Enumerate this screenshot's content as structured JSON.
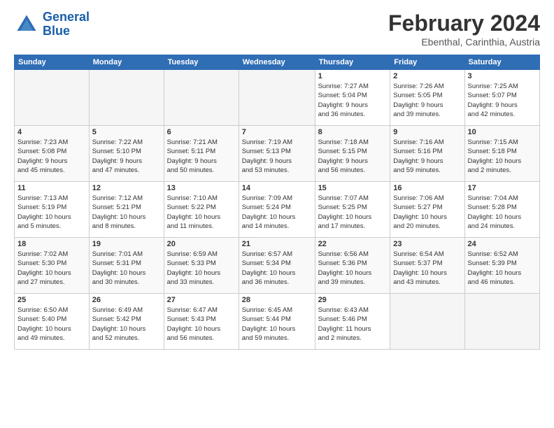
{
  "header": {
    "logo_line1": "General",
    "logo_line2": "Blue",
    "title": "February 2024",
    "subtitle": "Ebenthal, Carinthia, Austria"
  },
  "calendar": {
    "days_of_week": [
      "Sunday",
      "Monday",
      "Tuesday",
      "Wednesday",
      "Thursday",
      "Friday",
      "Saturday"
    ],
    "weeks": [
      [
        {
          "day": "",
          "info": ""
        },
        {
          "day": "",
          "info": ""
        },
        {
          "day": "",
          "info": ""
        },
        {
          "day": "",
          "info": ""
        },
        {
          "day": "1",
          "info": "Sunrise: 7:27 AM\nSunset: 5:04 PM\nDaylight: 9 hours\nand 36 minutes."
        },
        {
          "day": "2",
          "info": "Sunrise: 7:26 AM\nSunset: 5:05 PM\nDaylight: 9 hours\nand 39 minutes."
        },
        {
          "day": "3",
          "info": "Sunrise: 7:25 AM\nSunset: 5:07 PM\nDaylight: 9 hours\nand 42 minutes."
        }
      ],
      [
        {
          "day": "4",
          "info": "Sunrise: 7:23 AM\nSunset: 5:08 PM\nDaylight: 9 hours\nand 45 minutes."
        },
        {
          "day": "5",
          "info": "Sunrise: 7:22 AM\nSunset: 5:10 PM\nDaylight: 9 hours\nand 47 minutes."
        },
        {
          "day": "6",
          "info": "Sunrise: 7:21 AM\nSunset: 5:11 PM\nDaylight: 9 hours\nand 50 minutes."
        },
        {
          "day": "7",
          "info": "Sunrise: 7:19 AM\nSunset: 5:13 PM\nDaylight: 9 hours\nand 53 minutes."
        },
        {
          "day": "8",
          "info": "Sunrise: 7:18 AM\nSunset: 5:15 PM\nDaylight: 9 hours\nand 56 minutes."
        },
        {
          "day": "9",
          "info": "Sunrise: 7:16 AM\nSunset: 5:16 PM\nDaylight: 9 hours\nand 59 minutes."
        },
        {
          "day": "10",
          "info": "Sunrise: 7:15 AM\nSunset: 5:18 PM\nDaylight: 10 hours\nand 2 minutes."
        }
      ],
      [
        {
          "day": "11",
          "info": "Sunrise: 7:13 AM\nSunset: 5:19 PM\nDaylight: 10 hours\nand 5 minutes."
        },
        {
          "day": "12",
          "info": "Sunrise: 7:12 AM\nSunset: 5:21 PM\nDaylight: 10 hours\nand 8 minutes."
        },
        {
          "day": "13",
          "info": "Sunrise: 7:10 AM\nSunset: 5:22 PM\nDaylight: 10 hours\nand 11 minutes."
        },
        {
          "day": "14",
          "info": "Sunrise: 7:09 AM\nSunset: 5:24 PM\nDaylight: 10 hours\nand 14 minutes."
        },
        {
          "day": "15",
          "info": "Sunrise: 7:07 AM\nSunset: 5:25 PM\nDaylight: 10 hours\nand 17 minutes."
        },
        {
          "day": "16",
          "info": "Sunrise: 7:06 AM\nSunset: 5:27 PM\nDaylight: 10 hours\nand 20 minutes."
        },
        {
          "day": "17",
          "info": "Sunrise: 7:04 AM\nSunset: 5:28 PM\nDaylight: 10 hours\nand 24 minutes."
        }
      ],
      [
        {
          "day": "18",
          "info": "Sunrise: 7:02 AM\nSunset: 5:30 PM\nDaylight: 10 hours\nand 27 minutes."
        },
        {
          "day": "19",
          "info": "Sunrise: 7:01 AM\nSunset: 5:31 PM\nDaylight: 10 hours\nand 30 minutes."
        },
        {
          "day": "20",
          "info": "Sunrise: 6:59 AM\nSunset: 5:33 PM\nDaylight: 10 hours\nand 33 minutes."
        },
        {
          "day": "21",
          "info": "Sunrise: 6:57 AM\nSunset: 5:34 PM\nDaylight: 10 hours\nand 36 minutes."
        },
        {
          "day": "22",
          "info": "Sunrise: 6:56 AM\nSunset: 5:36 PM\nDaylight: 10 hours\nand 39 minutes."
        },
        {
          "day": "23",
          "info": "Sunrise: 6:54 AM\nSunset: 5:37 PM\nDaylight: 10 hours\nand 43 minutes."
        },
        {
          "day": "24",
          "info": "Sunrise: 6:52 AM\nSunset: 5:39 PM\nDaylight: 10 hours\nand 46 minutes."
        }
      ],
      [
        {
          "day": "25",
          "info": "Sunrise: 6:50 AM\nSunset: 5:40 PM\nDaylight: 10 hours\nand 49 minutes."
        },
        {
          "day": "26",
          "info": "Sunrise: 6:49 AM\nSunset: 5:42 PM\nDaylight: 10 hours\nand 52 minutes."
        },
        {
          "day": "27",
          "info": "Sunrise: 6:47 AM\nSunset: 5:43 PM\nDaylight: 10 hours\nand 56 minutes."
        },
        {
          "day": "28",
          "info": "Sunrise: 6:45 AM\nSunset: 5:44 PM\nDaylight: 10 hours\nand 59 minutes."
        },
        {
          "day": "29",
          "info": "Sunrise: 6:43 AM\nSunset: 5:46 PM\nDaylight: 11 hours\nand 2 minutes."
        },
        {
          "day": "",
          "info": ""
        },
        {
          "day": "",
          "info": ""
        }
      ]
    ]
  }
}
